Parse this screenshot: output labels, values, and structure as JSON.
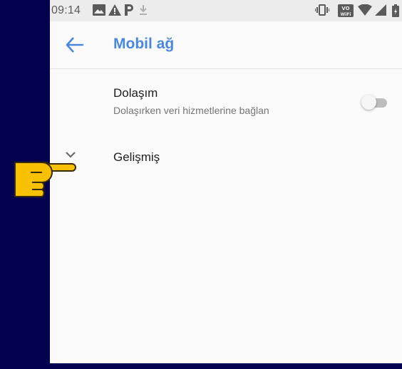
{
  "status_bar": {
    "time": "09:14",
    "left_icons": [
      "image-icon",
      "warning-icon",
      "parking-icon",
      "download-icon"
    ],
    "right_icons": [
      "vibrate-icon",
      "vo-wifi-icon",
      "wifi-icon",
      "cell-signal-icon",
      "battery-icon"
    ],
    "vowifi_text": "VO WiFi"
  },
  "app_bar": {
    "back_icon": "arrow-back-icon",
    "title": "Mobil ağ"
  },
  "settings": {
    "roaming": {
      "title": "Dolaşım",
      "subtitle": "Dolaşırken veri hizmetlerine bağlan",
      "enabled": false
    },
    "advanced": {
      "label": "Gelişmiş",
      "icon": "chevron-down-icon"
    }
  },
  "overlay": {
    "pointer_icon": "pointing-hand-icon",
    "color": "#f7c000"
  },
  "colors": {
    "accent": "#4a88e0",
    "background": "#02004f"
  }
}
